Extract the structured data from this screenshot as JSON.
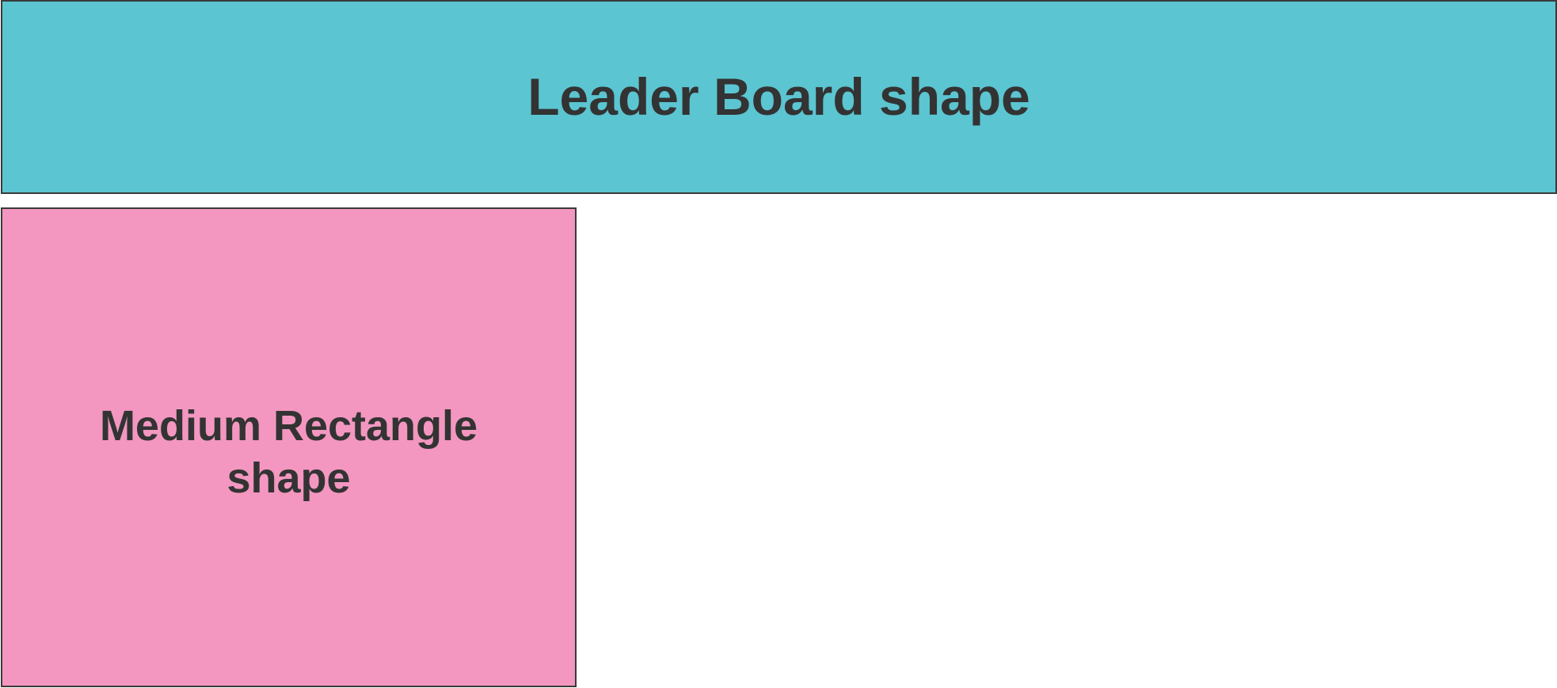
{
  "diagram": {
    "shapes": [
      {
        "id": "leader-board",
        "label": "Leader Board shape",
        "fill": "#5bc5d1",
        "border": "#3a3a3a"
      },
      {
        "id": "medium-rectangle",
        "label": "Medium Rectangle shape",
        "fill": "#f397c0",
        "border": "#3a3a3a"
      }
    ],
    "label_color": "#333333",
    "background": "#ffffff"
  }
}
